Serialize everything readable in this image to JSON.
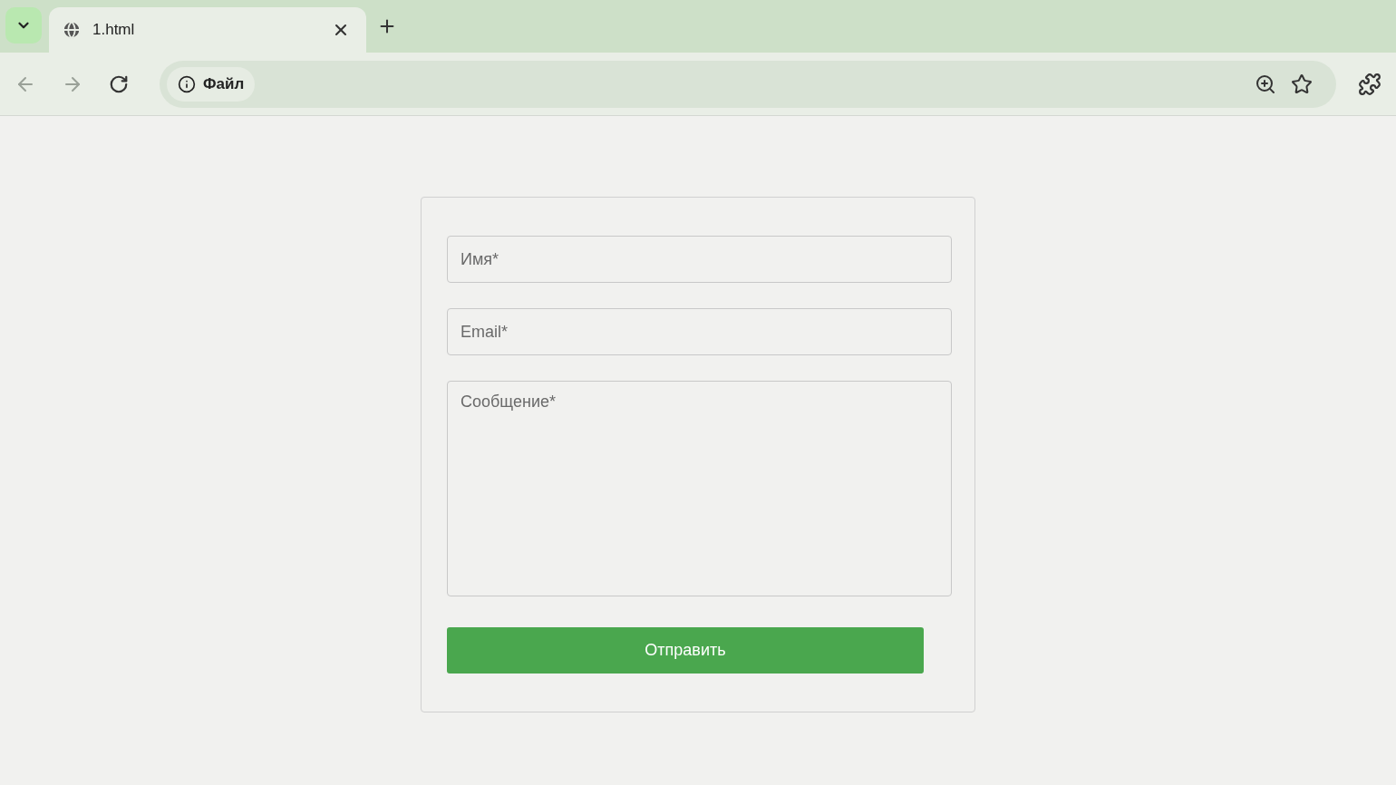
{
  "browser": {
    "tabs": [
      {
        "title": "1.html",
        "selected": true
      }
    ],
    "nav": {
      "back_disabled": true,
      "forward_disabled": true
    },
    "address": {
      "label": "Файл"
    }
  },
  "form": {
    "fields": [
      {
        "kind": "input",
        "placeholder": "Имя*"
      },
      {
        "kind": "input",
        "placeholder": "Email*"
      },
      {
        "kind": "textarea",
        "placeholder": "Сообщение*"
      }
    ],
    "submit": "Отправить"
  }
}
